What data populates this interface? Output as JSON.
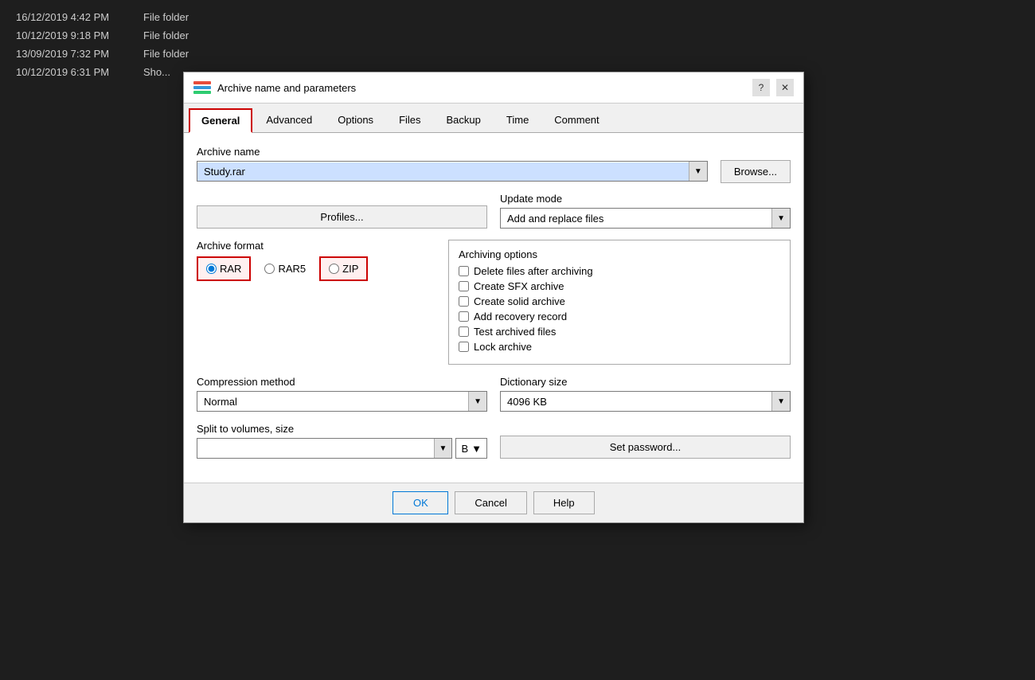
{
  "background": {
    "rows": [
      {
        "date": "16/12/2019 4:42 PM",
        "type": "File folder"
      },
      {
        "date": "10/12/2019 9:18 PM",
        "type": "File folder"
      },
      {
        "date": "13/09/2019 7:32 PM",
        "type": "File folder"
      },
      {
        "date": "10/12/2019 6:31 PM",
        "type": "Sho..."
      }
    ]
  },
  "dialog": {
    "title": "Archive name and parameters",
    "help_btn": "?",
    "close_btn": "✕",
    "tabs": [
      {
        "label": "General",
        "active": true
      },
      {
        "label": "Advanced",
        "active": false
      },
      {
        "label": "Options",
        "active": false
      },
      {
        "label": "Files",
        "active": false
      },
      {
        "label": "Backup",
        "active": false
      },
      {
        "label": "Time",
        "active": false
      },
      {
        "label": "Comment",
        "active": false
      }
    ],
    "archive_name_label": "Archive name",
    "archive_name_value": "Study.rar",
    "browse_btn": "Browse...",
    "profiles_btn": "Profiles...",
    "update_mode_label": "Update mode",
    "update_mode_value": "Add and replace files",
    "archive_format_label": "Archive format",
    "format_options": [
      {
        "label": "RAR",
        "value": "RAR",
        "checked": true,
        "highlighted": true
      },
      {
        "label": "RAR5",
        "value": "RAR5",
        "checked": false,
        "highlighted": false
      },
      {
        "label": "ZIP",
        "value": "ZIP",
        "checked": false,
        "highlighted": true
      }
    ],
    "archiving_options_label": "Archiving options",
    "archiving_options": [
      {
        "label": "Delete files after archiving",
        "checked": false
      },
      {
        "label": "Create SFX archive",
        "checked": false
      },
      {
        "label": "Create solid archive",
        "checked": false
      },
      {
        "label": "Add recovery record",
        "checked": false
      },
      {
        "label": "Test archived files",
        "checked": false
      },
      {
        "label": "Lock archive",
        "checked": false
      }
    ],
    "compression_method_label": "Compression method",
    "compression_method_value": "Normal",
    "dictionary_size_label": "Dictionary size",
    "dictionary_size_value": "4096 KB",
    "split_volumes_label": "Split to volumes, size",
    "split_volumes_value": "",
    "split_unit_value": "B",
    "set_password_btn": "Set password...",
    "footer": {
      "ok": "OK",
      "cancel": "Cancel",
      "help": "Help"
    }
  }
}
